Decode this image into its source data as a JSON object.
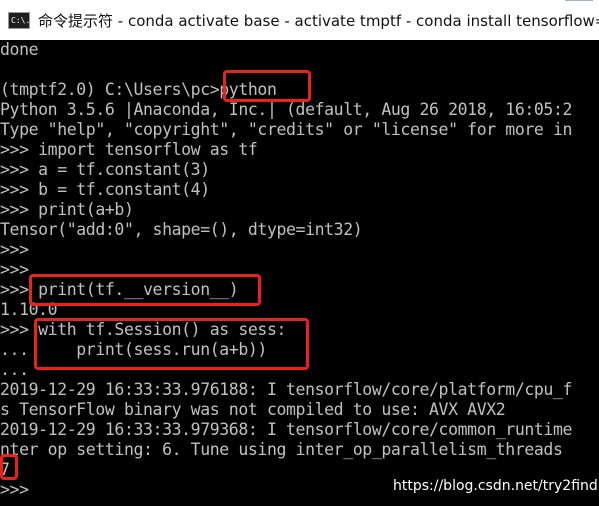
{
  "window": {
    "title": "命令提示符 - conda  activate base - activate  tmptf - conda  install tensorflow==",
    "icon": "cmd-icon",
    "icon_label": "C:\\."
  },
  "console": {
    "lines": [
      "done",
      "",
      "(tmptf2.0) C:\\Users\\pc>python",
      "Python 3.5.6 |Anaconda, Inc.| (default, Aug 26 2018, 16:05:2",
      "Type \"help\", \"copyright\", \"credits\" or \"license\" for more in",
      ">>> import tensorflow as tf",
      ">>> a = tf.constant(3)",
      ">>> b = tf.constant(4)",
      ">>> print(a+b)",
      "Tensor(\"add:0\", shape=(), dtype=int32)",
      ">>>",
      ">>>",
      ">>> print(tf.__version__)",
      "1.10.0",
      ">>> with tf.Session() as sess:",
      "...     print(sess.run(a+b))",
      "...",
      "2019-12-29 16:33:33.976188: I tensorflow/core/platform/cpu_f",
      "s TensorFlow binary was not compiled to use: AVX AVX2",
      "2019-12-29 16:33:33.979368: I tensorflow/core/common_runtime",
      "nter op setting: 6. Tune using inter_op_parallelism_threads",
      "7",
      ">>>"
    ]
  },
  "watermark": "https://blog.csdn.net/try2find",
  "colors": {
    "background": "#000000",
    "text": "#c0c0c0",
    "highlight": "#e8231c",
    "titlebar": "#ffffff"
  }
}
